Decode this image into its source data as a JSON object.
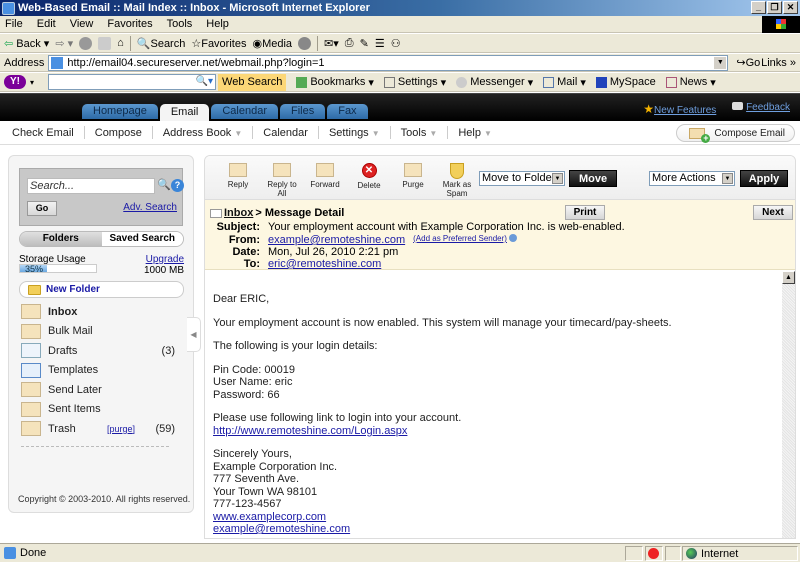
{
  "browser": {
    "window_title": "Web-Based Email :: Mail Index :: Inbox - Microsoft Internet Explorer",
    "menu": [
      "File",
      "Edit",
      "View",
      "Favorites",
      "Tools",
      "Help"
    ],
    "toolbar": {
      "back": "Back",
      "search": "Search",
      "favorites": "Favorites",
      "media": "Media"
    },
    "address_label": "Address",
    "url": "http://email04.secureserver.net/webmail.php?login=1",
    "go_label": "Go",
    "links_label": "Links",
    "yahoo": {
      "web_search": "Web Search",
      "items": [
        "Bookmarks",
        "Settings",
        "Messenger",
        "Mail",
        "MySpace",
        "News"
      ]
    },
    "status": {
      "text": "Done",
      "zone": "Internet"
    }
  },
  "webmail": {
    "tabs": [
      {
        "label": "Homepage",
        "active": false
      },
      {
        "label": "Email",
        "active": true
      },
      {
        "label": "Calendar",
        "active": false
      },
      {
        "label": "Files",
        "active": false
      },
      {
        "label": "Fax",
        "active": false
      }
    ],
    "header_links": {
      "new_features": "New Features",
      "feedback": "Feedback"
    },
    "nav": [
      "Check Email",
      "Compose",
      "Address Book",
      "Calendar",
      "Settings",
      "Tools",
      "Help"
    ],
    "compose_button": "Compose Email",
    "sidebar": {
      "search_placeholder": "Search...",
      "go": "Go",
      "adv_search": "Adv. Search",
      "segments": {
        "folders": "Folders",
        "saved_search": "Saved Search"
      },
      "storage": {
        "label": "Storage Usage",
        "percent_text": "35%",
        "percent": 35,
        "upgrade": "Upgrade",
        "capacity": "1000 MB"
      },
      "new_folder": "New Folder",
      "folders": [
        {
          "name": "Inbox",
          "count": "",
          "bold": true
        },
        {
          "name": "Bulk Mail",
          "count": ""
        },
        {
          "name": "Drafts",
          "count": "(3)"
        },
        {
          "name": "Templates",
          "count": ""
        },
        {
          "name": "Send Later",
          "count": ""
        },
        {
          "name": "Sent Items",
          "count": ""
        },
        {
          "name": "Trash",
          "count": "(59)",
          "purge": "[purge]"
        }
      ],
      "copyright": "Copyright © 2003-2010. All rights reserved."
    },
    "actions": {
      "reply": "Reply",
      "reply_all": "Reply to All",
      "forward": "Forward",
      "delete": "Delete",
      "purge": "Purge",
      "spam_line1": "Mark as",
      "spam_line2": "Spam",
      "move_select": "Move to Folder",
      "move_btn": "Move",
      "more_select": "More Actions",
      "apply_btn": "Apply"
    },
    "message": {
      "crumb_inbox": "Inbox",
      "crumb_rest": "> Message Detail",
      "print": "Print",
      "next": "Next",
      "labels": {
        "subject": "Subject:",
        "from": "From:",
        "date": "Date:",
        "to": "To:"
      },
      "subject": "Your employment account with Example Corporation Inc. is web-enabled.",
      "from": "example@remoteshine.com",
      "preferred": "(Add as Preferred Sender)",
      "date": "Mon, Jul 26, 2010 2:21 pm",
      "to": "eric@remoteshine.com",
      "body": {
        "greeting": "Dear  ERIC,",
        "p1": "Your employment account is now enabled. This system will manage your timecard/pay-sheets.",
        "p2": "The following is your login details:",
        "pin": "Pin Code:  00019",
        "user": "User Name:  eric",
        "pass": "Password:  66",
        "p3": "Please use following link to login into your account.",
        "link": "http://www.remoteshine.com/Login.aspx",
        "sig": [
          "Sincerely Yours,",
          "Example Corporation Inc.",
          "777 Seventh Ave.",
          "Your Town WA 98101",
          "777-123-4567"
        ],
        "sig_web": "www.examplecorp.com",
        "sig_email": "example@remoteshine.com"
      }
    }
  }
}
